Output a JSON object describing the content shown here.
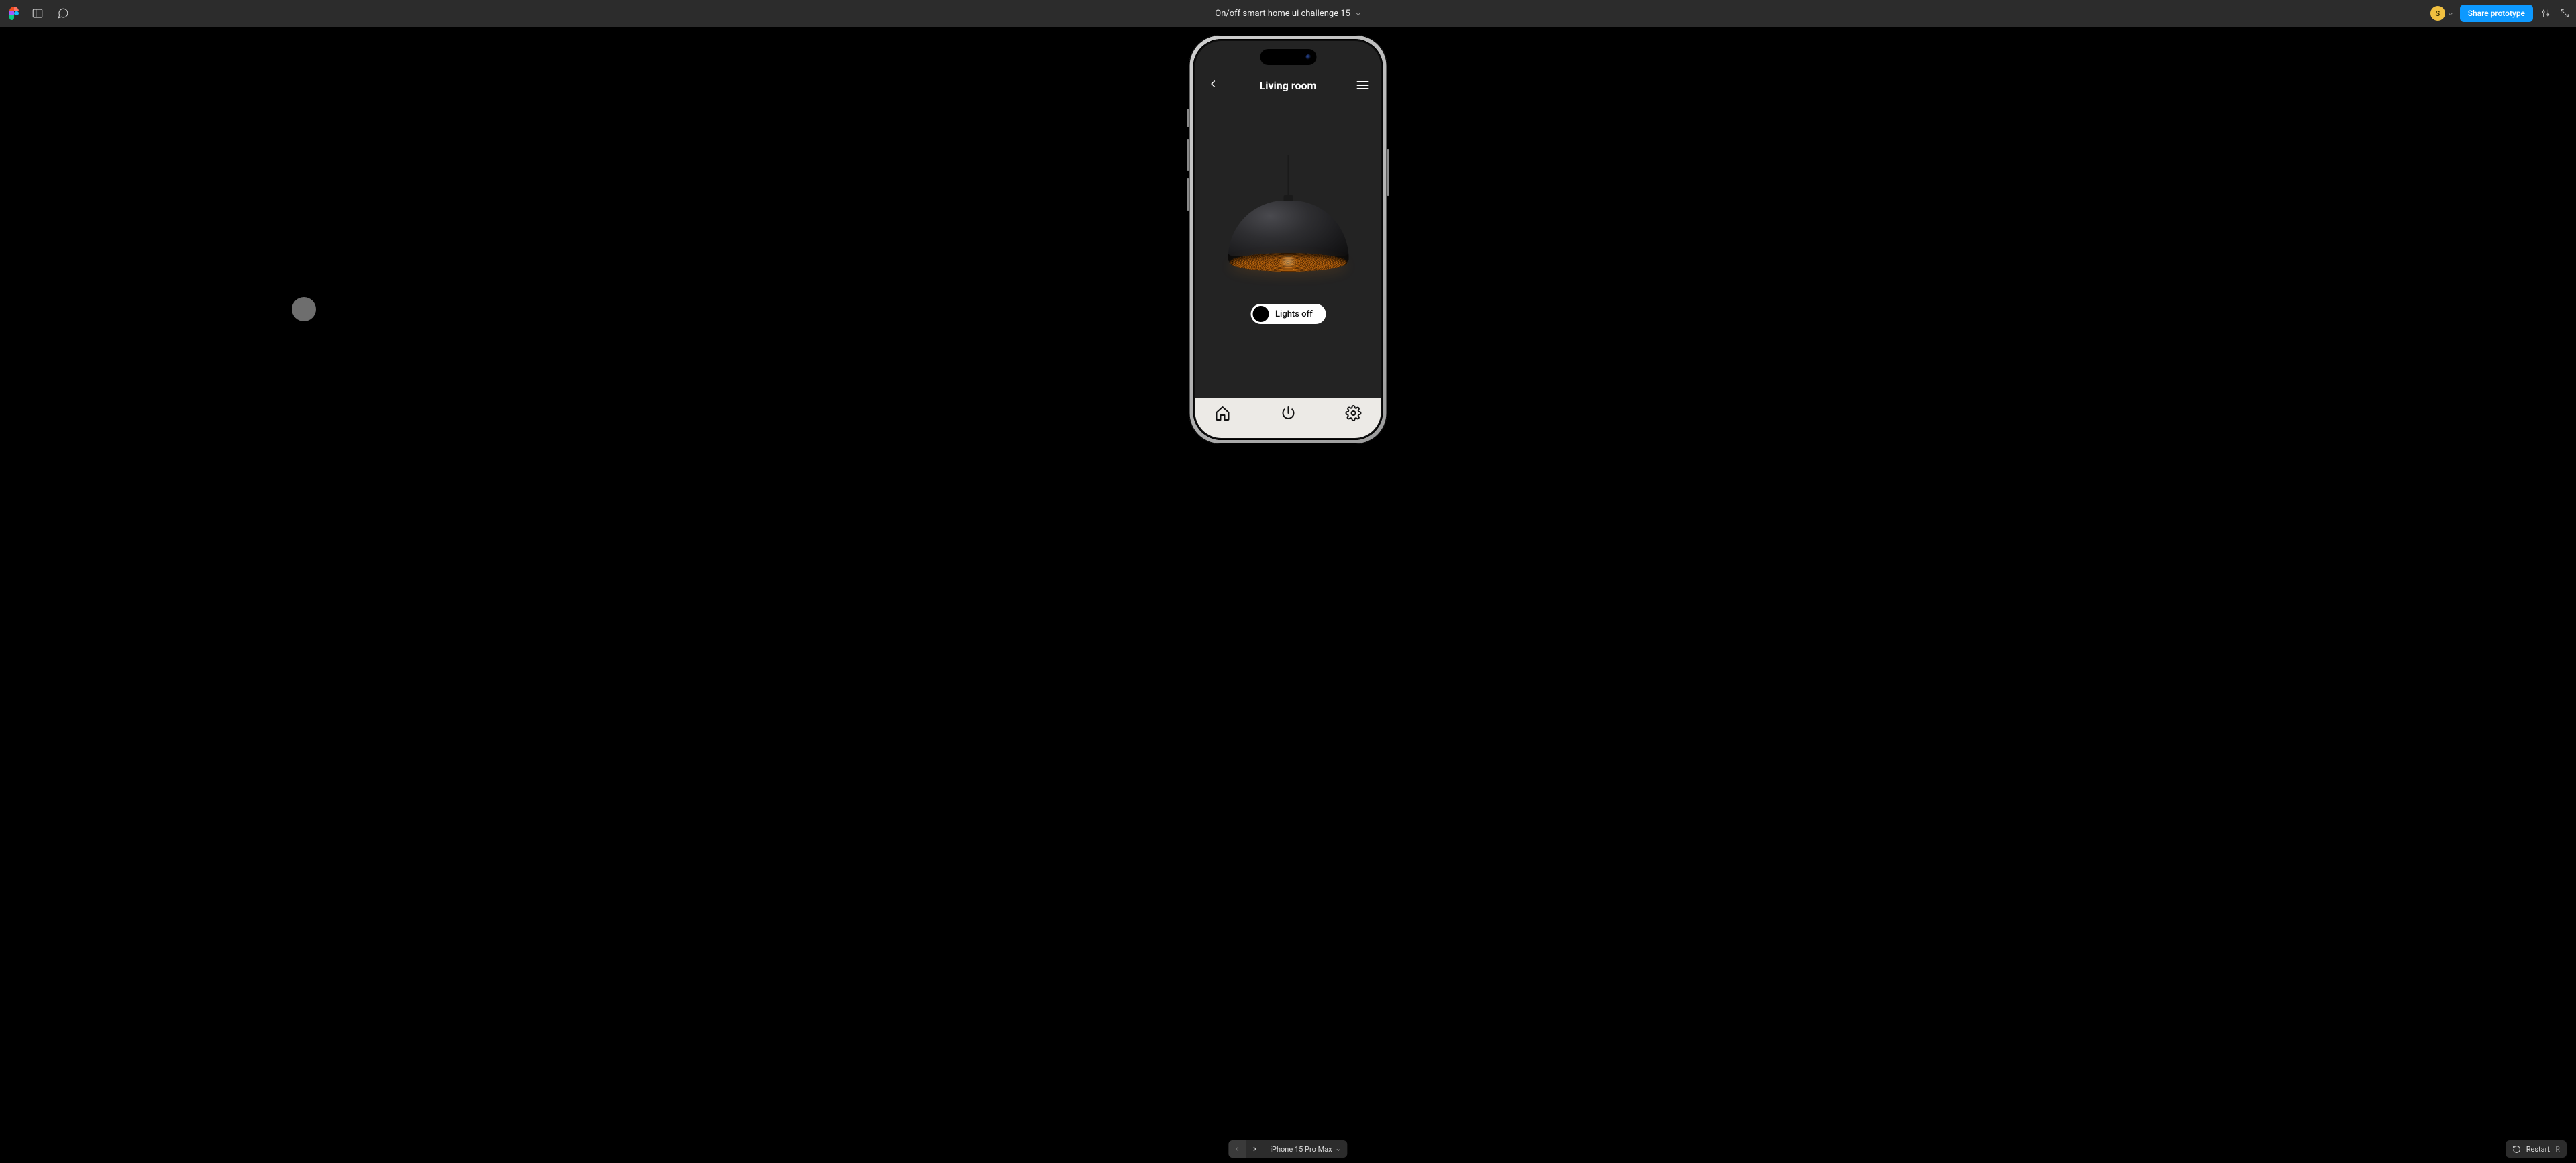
{
  "figma": {
    "file_title": "On/off smart home ui challenge 15",
    "avatar_initial": "S",
    "share_label": "Share prototype",
    "device_label": "iPhone 15 Pro Max",
    "restart_label": "Restart",
    "restart_key": "R"
  },
  "app": {
    "screen_title": "Living room",
    "toggle_label": "Lights off",
    "toggle_on": false,
    "icons": {
      "back": "chevron-left-icon",
      "menu": "hamburger-icon",
      "home": "home-icon",
      "power": "power-icon",
      "settings": "gear-icon"
    }
  },
  "colors": {
    "figma_bar": "#2c2c2c",
    "figma_primary": "#0d99ff",
    "app_bg": "#232323",
    "tabbar_bg": "#eceae6",
    "lamp_glow": "#f2a429"
  }
}
